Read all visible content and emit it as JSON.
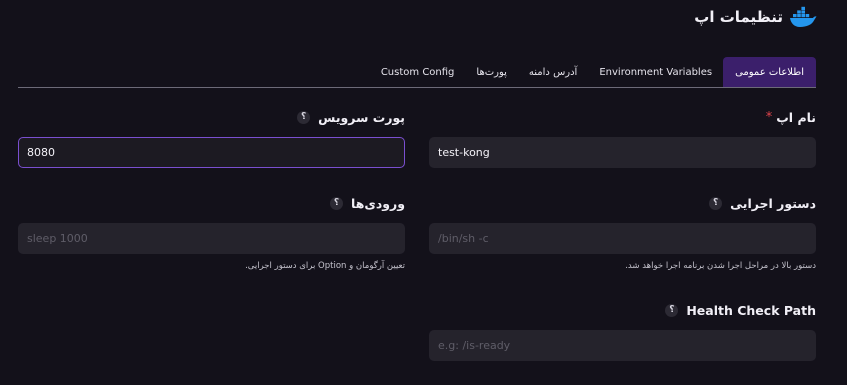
{
  "header": {
    "title": "تنظیمات اپ",
    "logo_icon": "docker-whale-icon"
  },
  "tabs": [
    {
      "label": "اطلاعات عمومی",
      "active": true
    },
    {
      "label": "Environment Variables",
      "active": false
    },
    {
      "label": "آدرس دامنه",
      "active": false
    },
    {
      "label": "پورت‌ها",
      "active": false
    },
    {
      "label": "Custom Config",
      "active": false
    }
  ],
  "fields": {
    "app_name": {
      "label": "نام اپ",
      "required_mark": "*",
      "value": "test-kong"
    },
    "service_port": {
      "label": "پورت سرویس",
      "value": "8080"
    },
    "command": {
      "label": "دستور اجرایی",
      "placeholder": "/bin/sh -c",
      "hint": "دستور بالا در مراحل اجرا شدن برنامه اجرا خواهد شد."
    },
    "args": {
      "label": "ورودی‌ها",
      "placeholder": "sleep 1000",
      "hint": "تعیین آرگومان و Option برای دستور اجرایی."
    },
    "health_check": {
      "label": "Health Check Path",
      "placeholder": "e.g: /is-ready"
    }
  },
  "help_glyph": "؟",
  "colors": {
    "accent": "#7a4fd0",
    "active_tab": "#3b1f6b",
    "required": "#e0434c",
    "logo": "#2496ed"
  }
}
